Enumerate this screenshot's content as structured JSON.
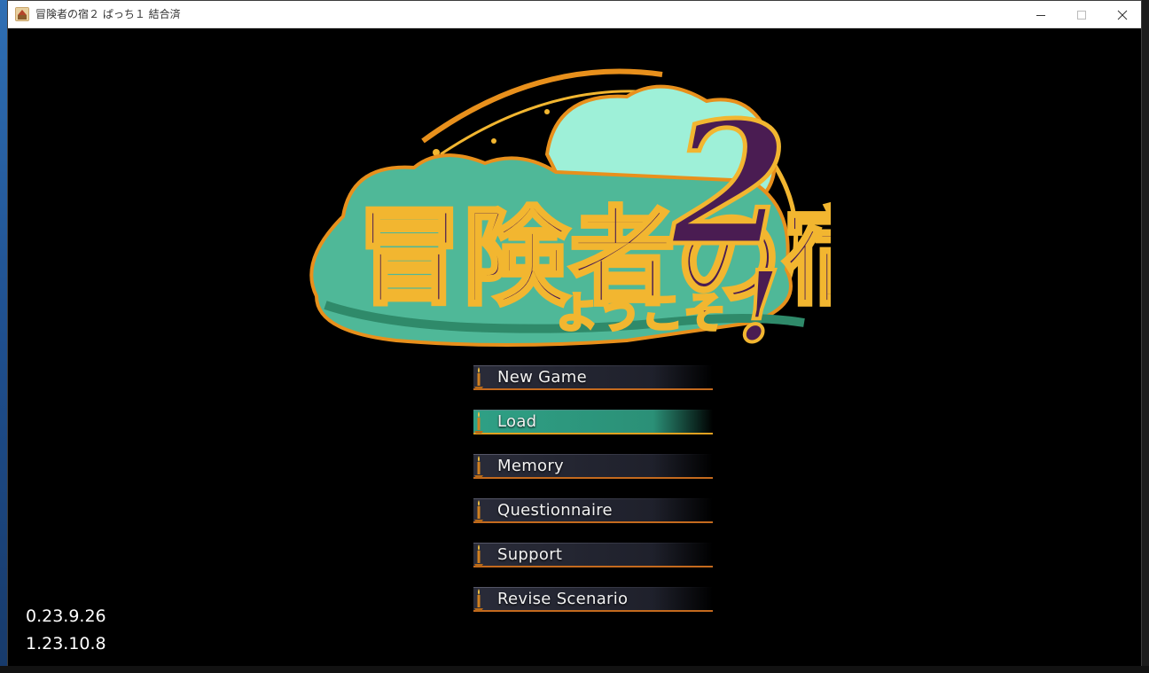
{
  "window": {
    "title": "冒険者の宿２ ぱっち１ 結合済"
  },
  "logo": {
    "main_text": "冒険者の宿へ",
    "sub_text": "ようこそ",
    "number": "2",
    "exclamation": "!"
  },
  "menu": {
    "items": [
      {
        "label": "New Game"
      },
      {
        "label": "Load"
      },
      {
        "label": "Memory"
      },
      {
        "label": "Questionnaire"
      },
      {
        "label": "Support"
      },
      {
        "label": "Revise Scenario"
      }
    ],
    "selected_index": 1
  },
  "versions": [
    "0.23.9.26",
    "1.23.10.8"
  ],
  "colors": {
    "menu_selected": "#2fa085",
    "menu_accent": "#c46a1e",
    "logo_teal": "#4fb898",
    "logo_purple": "#4a1c52",
    "logo_orange": "#e8901c"
  }
}
